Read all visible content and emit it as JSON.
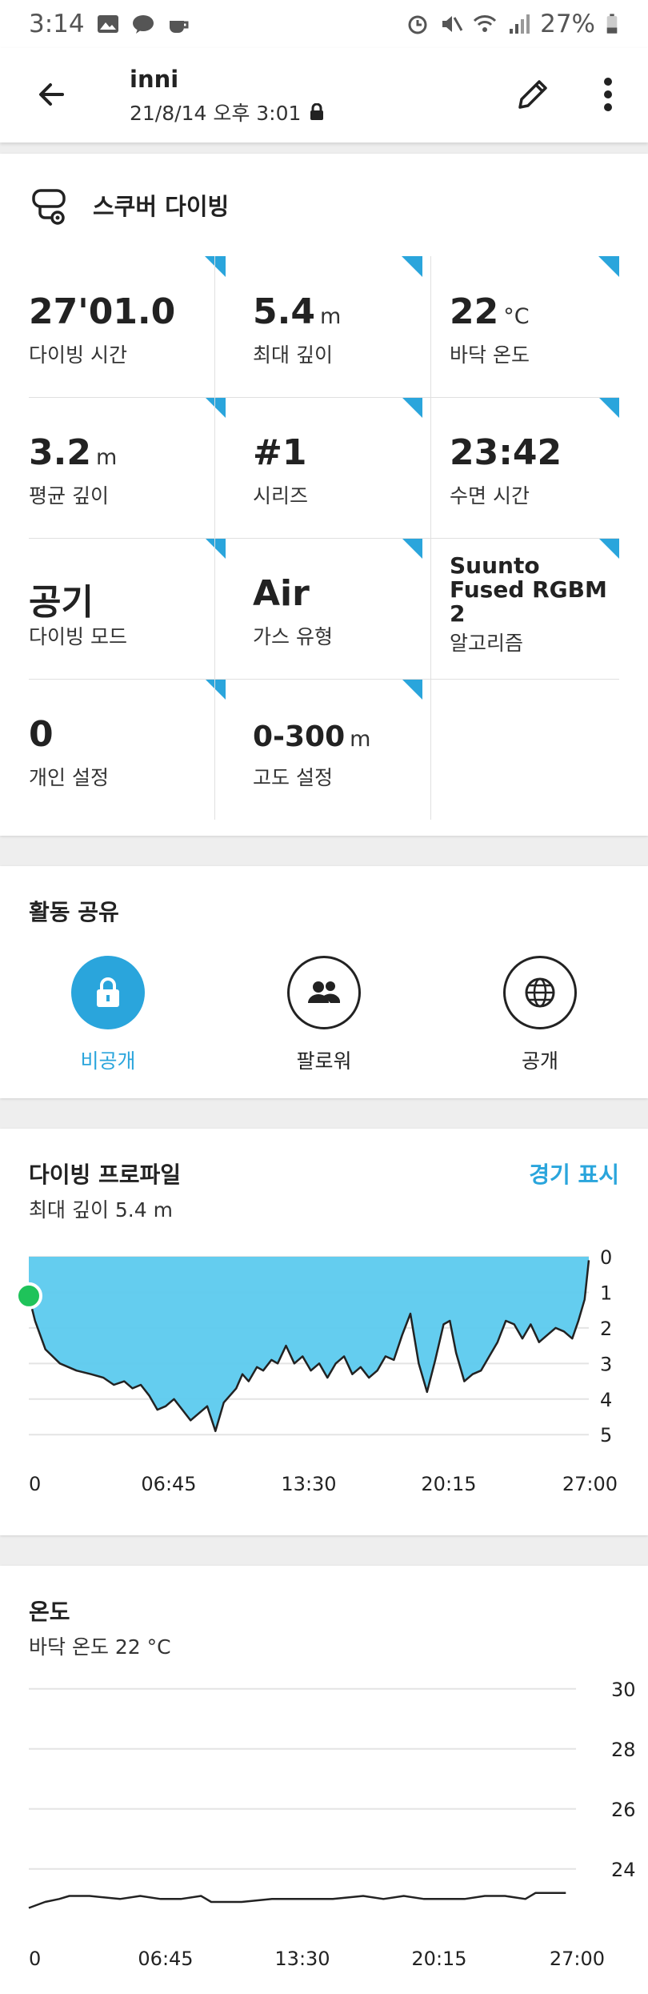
{
  "status_bar": {
    "time": "3:14",
    "battery": "27%"
  },
  "header": {
    "title": "inni",
    "datetime": "21/8/14 오후 3:01"
  },
  "summary": {
    "title": "스쿠버 다이빙",
    "stats": [
      {
        "value": "27'01.0",
        "unit": "",
        "label": "다이빙 시간"
      },
      {
        "value": "5.4",
        "unit": "m",
        "label": "최대 깊이"
      },
      {
        "value": "22",
        "unit": "°C",
        "label": "바닥 온도"
      },
      {
        "value": "3.2",
        "unit": "m",
        "label": "평균 깊이"
      },
      {
        "value": "#1",
        "unit": "",
        "label": "시리즈"
      },
      {
        "value": "23:42",
        "unit": "",
        "label": "수면 시간"
      },
      {
        "value": "공기",
        "unit": "",
        "label": "다이빙 모드"
      },
      {
        "value": "Air",
        "unit": "",
        "label": "가스 유형"
      },
      {
        "value": "Suunto Fused RGBM 2",
        "unit": "",
        "label": "알고리즘"
      },
      {
        "value": "0",
        "unit": "",
        "label": "개인 설정"
      },
      {
        "value": "0-300",
        "unit": "m",
        "label": "고도 설정"
      }
    ]
  },
  "share": {
    "title": "활동 공유",
    "options": [
      {
        "label": "비공개",
        "selected": true
      },
      {
        "label": "팔로워",
        "selected": false
      },
      {
        "label": "공개",
        "selected": false
      }
    ],
    "accent": "#2aa5dc"
  },
  "chart_data": [
    {
      "type": "area",
      "title": "다이빙 프로파일",
      "subtitle": "최대 깊이 5.4 m",
      "action": "경기 표시",
      "x_ticks": [
        "0",
        "06:45",
        "13:30",
        "20:15",
        "27:00"
      ],
      "y_ticks": [
        "0",
        "1",
        "2",
        "3",
        "4",
        "5"
      ],
      "y_inverted": true,
      "ylim": [
        0,
        5.4
      ],
      "xlim": [
        0,
        27.0
      ],
      "x_unit": "minutes",
      "x": [
        0,
        0.3,
        0.8,
        1.5,
        2.3,
        3.0,
        3.6,
        4.1,
        4.6,
        5.0,
        5.4,
        5.8,
        6.2,
        6.6,
        7.0,
        7.4,
        7.8,
        8.2,
        8.6,
        9.0,
        9.4,
        9.7,
        10.0,
        10.3,
        10.6,
        11.0,
        11.3,
        11.7,
        12.0,
        12.4,
        12.8,
        13.2,
        13.6,
        14.0,
        14.4,
        14.8,
        15.2,
        15.6,
        16.0,
        16.4,
        16.8,
        17.2,
        17.6,
        18.0,
        18.4,
        18.8,
        19.2,
        19.6,
        20.0,
        20.3,
        20.6,
        21.0,
        21.4,
        21.8,
        22.2,
        22.6,
        23.0,
        23.4,
        23.8,
        24.2,
        24.6,
        25.0,
        25.4,
        25.8,
        26.2,
        26.5,
        26.8,
        27.0
      ],
      "depth": [
        1.1,
        1.8,
        2.6,
        3.0,
        3.2,
        3.3,
        3.4,
        3.6,
        3.5,
        3.7,
        3.6,
        3.9,
        4.3,
        4.2,
        4.0,
        4.3,
        4.6,
        4.4,
        4.2,
        4.9,
        4.1,
        3.9,
        3.7,
        3.3,
        3.5,
        3.1,
        3.2,
        2.9,
        3.0,
        2.5,
        3.0,
        2.8,
        3.2,
        3.0,
        3.4,
        3.0,
        2.8,
        3.3,
        3.1,
        3.4,
        3.2,
        2.8,
        2.9,
        2.2,
        1.6,
        3.0,
        3.8,
        2.9,
        1.9,
        1.8,
        2.7,
        3.5,
        3.3,
        3.2,
        2.8,
        2.4,
        1.8,
        1.9,
        2.3,
        1.9,
        2.4,
        2.2,
        2.0,
        2.1,
        2.3,
        1.8,
        1.2,
        0.1
      ]
    },
    {
      "type": "line",
      "title": "온도",
      "subtitle": "바닥 온도 22 °C",
      "x_ticks": [
        "0",
        "06:45",
        "13:30",
        "20:15",
        "27:00"
      ],
      "y_ticks": [
        "30",
        "28",
        "26",
        "24"
      ],
      "ylim": [
        22.5,
        30.5
      ],
      "xlim": [
        0,
        27.0
      ],
      "x_unit": "minutes",
      "x": [
        0,
        0.8,
        1.5,
        2.0,
        3.0,
        4.5,
        5.5,
        6.5,
        7.5,
        8.5,
        9.0,
        10.5,
        12.0,
        13.0,
        14.0,
        15.0,
        16.5,
        17.5,
        18.5,
        19.5,
        20.5,
        21.5,
        22.5,
        23.5,
        24.5,
        25.0,
        26.0,
        26.5
      ],
      "y": [
        22.7,
        22.9,
        23.0,
        23.1,
        23.1,
        23.0,
        23.1,
        23.0,
        23.0,
        23.1,
        22.9,
        22.9,
        23.0,
        23.0,
        23.0,
        23.0,
        23.1,
        23.0,
        23.1,
        23.0,
        23.0,
        23.0,
        23.1,
        23.1,
        23.0,
        23.2,
        23.2,
        23.2
      ]
    }
  ],
  "colors": {
    "area_fill": "#5ccaee",
    "area_stroke": "#222222",
    "start_dot": "#1fc35a",
    "grid": "#e4e4e4"
  }
}
